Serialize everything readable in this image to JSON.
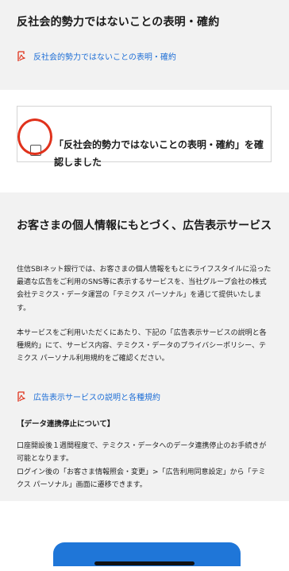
{
  "header": {
    "title": "反社会的勢力ではないことの表明・確約",
    "pdf_link_label": "反社会的勢力ではないことの表明・確約"
  },
  "confirmation": {
    "label": "「反社会的勢力ではないことの表明・確約」を確認しました",
    "checked": false
  },
  "ad_section": {
    "title": "お客さまの個人情報にもとづく、広告表示サービス",
    "paragraph1": "住信SBIネット銀行では、お客さまの個人情報をもとにライフスタイルに沿った最適な広告をご利用のSNS等に表示するサービスを、当社グループ会社の株式会社テミクス・データ運営の「テミクス パーソナル」を通じて提供いたします。",
    "paragraph2": "本サービスをご利用いただくにあたり、下記の「広告表示サービスの説明と各種規約」にて、サービス内容、テミクス・データのプライバシーポリシー、テミクス パーソナル利用規約をご確認ください。",
    "pdf_link_label": "広告表示サービスの説明と各種規約",
    "stop_heading": "【データ連携停止について】",
    "paragraph3": "口座開設後１週間程度で、テミクス・データへのデータ連携停止のお手続きが可能となります。",
    "paragraph4": "ログイン後の「お客さま情報照会・変更」>「広告利用同意設定」から「テミクス パーソナル」画面に遷移できます。"
  },
  "colors": {
    "accent": "#1f6fd6",
    "highlight_ring": "#e0321c",
    "pdf_icon": "#e0321c"
  }
}
